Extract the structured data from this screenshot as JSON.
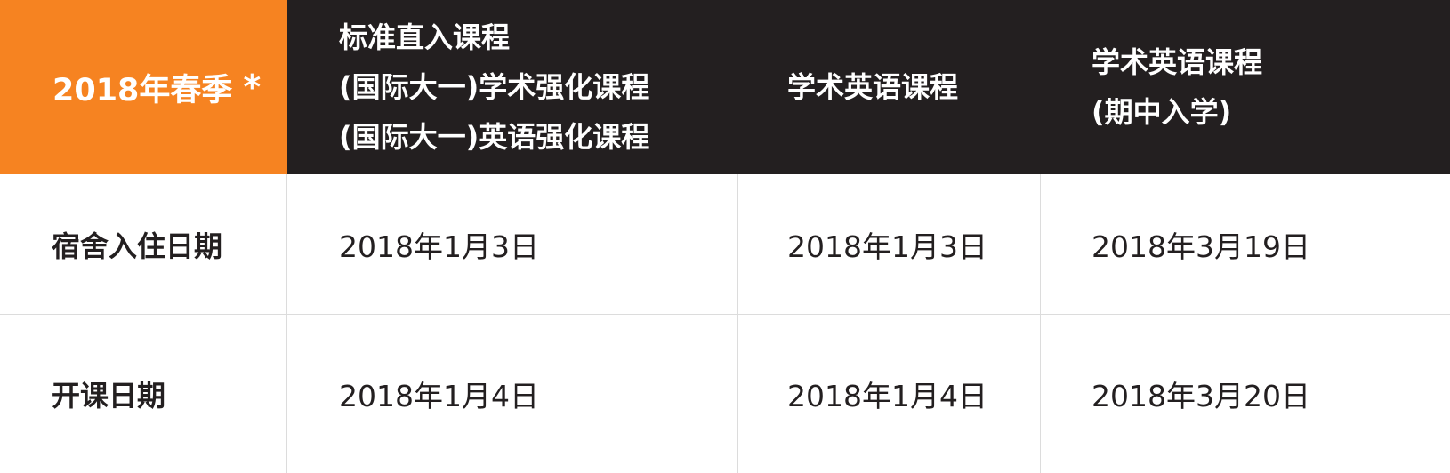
{
  "header": {
    "term": "2018年春季",
    "term_marker": "*",
    "columns": [
      {
        "lines": [
          "标准直入课程",
          "(国际大一)学术强化课程",
          "(国际大一)英语强化课程"
        ]
      },
      {
        "lines": [
          "学术英语课程"
        ]
      },
      {
        "lines": [
          "学术英语课程",
          "(期中入学)"
        ]
      }
    ]
  },
  "rows": [
    {
      "label": "宿舍入住日期",
      "values": [
        "2018年1月3日",
        "2018年1月3日",
        "2018年3月19日"
      ]
    },
    {
      "label": "开课日期",
      "values": [
        "2018年1月4日",
        "2018年1月4日",
        "2018年3月20日"
      ]
    }
  ],
  "colors": {
    "accent": "#f68321",
    "header_bg": "#231f20",
    "divider": "#dcdcdc"
  }
}
